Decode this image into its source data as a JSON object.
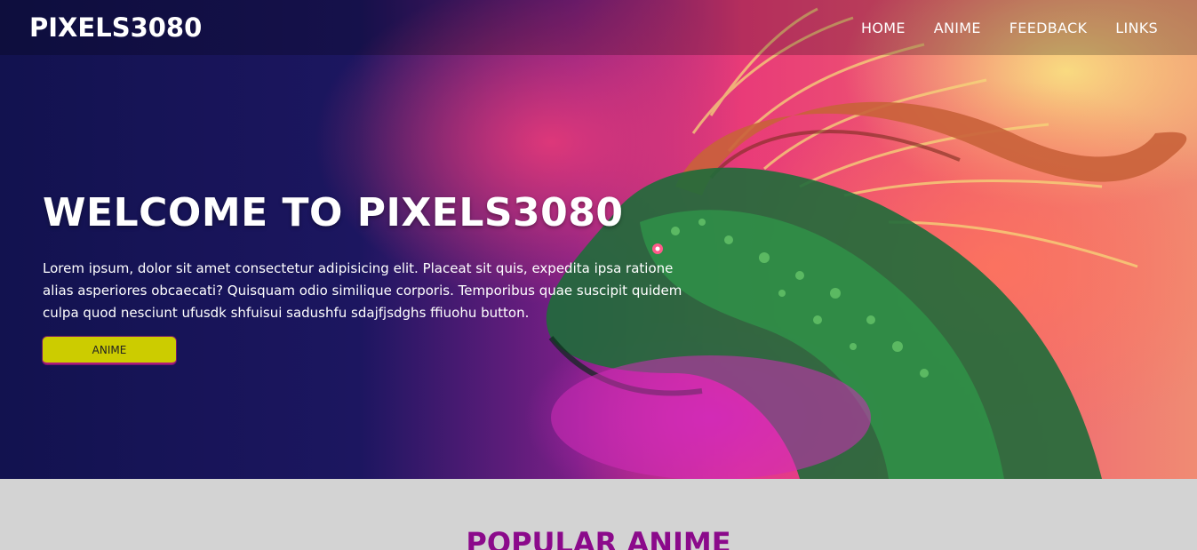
{
  "navbar": {
    "logo": "PIXELS3080",
    "links": [
      "HOME",
      "ANIME",
      "FEEDBACK",
      "LINKS"
    ]
  },
  "hero": {
    "title": "WELCOME TO PIXELS3080",
    "text": "Lorem ipsum, dolor sit amet consectetur adipisicing elit. Placeat sit quis, expedita ipsa ratione alias asperiores obcaecati? Quisquam odio similique corporis. Temporibus quae suscipit quidem culpa quod nesciunt ufusdk shfuisui sadushfu sdajfjsdghs ffiuohu button.",
    "button_label": "ANIME",
    "image": "dragon-illustration"
  },
  "popular_section": {
    "title": "POPULAR ANIME"
  },
  "colors": {
    "accent_button": "#cccc00",
    "section_title": "#8b0a8b",
    "section_bg": "#d3d3d3"
  }
}
